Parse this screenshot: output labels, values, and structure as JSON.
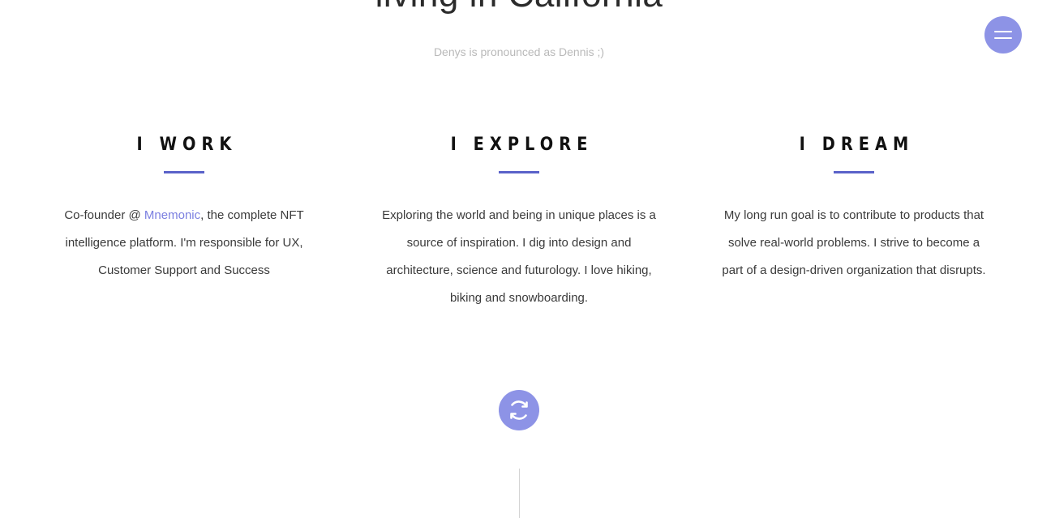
{
  "hero": {
    "heading": "living in California",
    "subtitle": "Denys is pronounced as Dennis ;)"
  },
  "nav": {
    "menu_icon": "hamburger-icon"
  },
  "columns": [
    {
      "title": "I WORK",
      "text_before_link": "Co-founder @ ",
      "link_text": "Mnemonic",
      "text_after_link": ", the complete NFT intelligence platform. I'm responsible for UX, Customer Support and Success"
    },
    {
      "title": "I EXPLORE",
      "text": "Exploring the world and being in unique places is a source of inspiration. I dig into design and architecture, science and futurology. I love hiking, biking and snowboarding."
    },
    {
      "title": "I DREAM",
      "text": "My long run goal is to contribute to products that solve real-world problems. I strive to become a part of a design-driven organization that disrupts."
    }
  ],
  "refresh": {
    "icon": "refresh-icon"
  },
  "colors": {
    "accent": "#8d93e6",
    "divider": "#5a62c9",
    "link": "#7b7fe0",
    "subtitle": "#b9b9b9"
  }
}
